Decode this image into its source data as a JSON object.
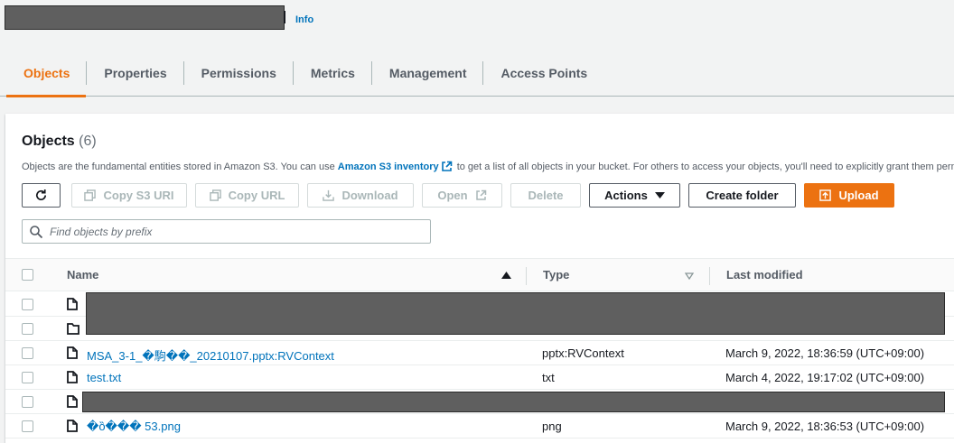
{
  "header": {
    "info_label": "Info"
  },
  "tabs": [
    {
      "label": "Objects"
    },
    {
      "label": "Properties"
    },
    {
      "label": "Permissions"
    },
    {
      "label": "Metrics"
    },
    {
      "label": "Management"
    },
    {
      "label": "Access Points"
    }
  ],
  "objects_panel": {
    "title": "Objects",
    "count": "(6)",
    "description_before": "Objects are the fundamental entities stored in Amazon S3. You can use ",
    "description_link": "Amazon S3 inventory",
    "description_after": " to get a list of all objects in your bucket. For others to access your objects, you'll need to explicitly grant them permissions."
  },
  "toolbar": {
    "copy_s3_uri": "Copy S3 URI",
    "copy_url": "Copy URL",
    "download": "Download",
    "open": "Open",
    "delete": "Delete",
    "actions": "Actions",
    "create_folder": "Create folder",
    "upload": "Upload"
  },
  "search": {
    "placeholder": "Find objects by prefix"
  },
  "table": {
    "columns": [
      "Name",
      "Type",
      "Last modified"
    ],
    "rows": [
      {
        "icon": "file-icon",
        "name": "",
        "type": "",
        "last_modified": "",
        "redacted": true
      },
      {
        "icon": "folder-icon",
        "name": "",
        "type": "",
        "last_modified": "",
        "redacted": true
      },
      {
        "icon": "file-icon",
        "name": "MSA_3-1_�駒��_20210107.pptx:RVContext",
        "type": "pptx:RVContext",
        "last_modified": "March 9, 2022, 18:36:59 (UTC+09:00)"
      },
      {
        "icon": "file-icon",
        "name": "test.txt",
        "type": "txt",
        "last_modified": "March 4, 2022, 19:17:02 (UTC+09:00)"
      },
      {
        "icon": "file-icon",
        "name": "",
        "type": "",
        "last_modified": "",
        "redacted": true
      },
      {
        "icon": "file-icon",
        "name": "�ȍ��� 53.png",
        "type": "png",
        "last_modified": "March 9, 2022, 18:36:53 (UTC+09:00)"
      }
    ]
  },
  "colors": {
    "accent": "#ec7211",
    "link": "#0073bb"
  }
}
